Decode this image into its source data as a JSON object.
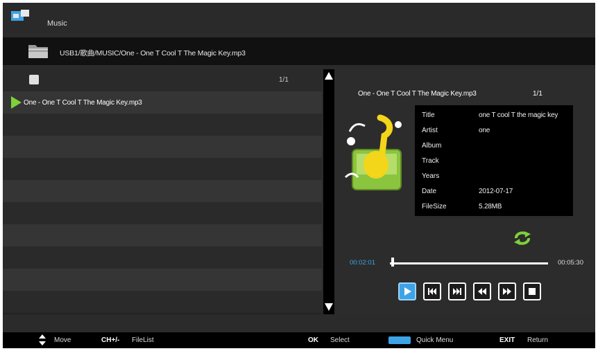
{
  "header": {
    "title": "Music"
  },
  "path": {
    "text": "USB1/歌曲/MUSIC/One - One T Cool T The Magic Key.mp3"
  },
  "file_list": {
    "page_count": "1/1",
    "items": [
      {
        "label": "One - One T Cool T The Magic Key.mp3"
      }
    ]
  },
  "now_playing": {
    "filename": "One - One T Cool T The Magic Key.mp3",
    "count": "1/1"
  },
  "info": {
    "rows": [
      {
        "label": "Title",
        "value": "one T cool T the magic key"
      },
      {
        "label": "Artist",
        "value": "one"
      },
      {
        "label": "Album",
        "value": ""
      },
      {
        "label": "Track",
        "value": ""
      },
      {
        "label": "Years",
        "value": ""
      },
      {
        "label": "Date",
        "value": "2012-07-17"
      },
      {
        "label": "FileSize",
        "value": "5.28MB"
      }
    ]
  },
  "playback": {
    "current_time": "00:02:01",
    "total_time": "00:05:30",
    "progress_fraction": 0.01
  },
  "controls": [
    {
      "name": "play",
      "icon": "play-icon",
      "active": true
    },
    {
      "name": "previous",
      "icon": "previous-icon"
    },
    {
      "name": "next",
      "icon": "next-icon"
    },
    {
      "name": "rewind",
      "icon": "rewind-icon"
    },
    {
      "name": "fast-forward",
      "icon": "fast-forward-icon"
    },
    {
      "name": "stop",
      "icon": "stop-icon"
    }
  ],
  "footer": {
    "move_label": "Move",
    "ch_key": "CH+/-",
    "filelist_label": "FileList",
    "ok_key": "OK",
    "select_label": "Select",
    "quick_menu_label": "Quick Menu",
    "exit_key": "EXIT",
    "return_label": "Return"
  },
  "colors": {
    "accent": "#3ea3e6",
    "highlight": "#7fd13b",
    "background": "#2b2b2b"
  }
}
